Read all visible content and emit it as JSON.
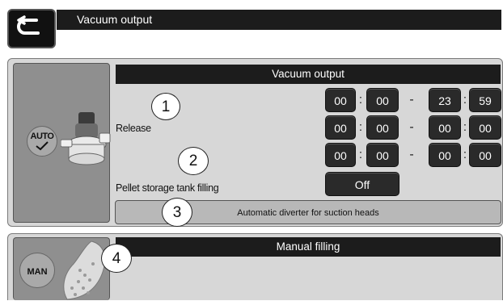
{
  "header": {
    "title": "Vacuum output"
  },
  "auto_section": {
    "mode_label": "AUTO",
    "title": "Vacuum output",
    "release_label": "Release",
    "pellet_label": "Pellet storage tank filling",
    "time_windows": [
      {
        "start_h": "00",
        "start_m": "00",
        "end_h": "23",
        "end_m": "59"
      },
      {
        "start_h": "00",
        "start_m": "00",
        "end_h": "00",
        "end_m": "00"
      },
      {
        "start_h": "00",
        "start_m": "00",
        "end_h": "00",
        "end_m": "00"
      }
    ],
    "separator": ":",
    "dash": "-",
    "pellet_value": "Off",
    "diverter_label": "Automatic diverter for suction heads"
  },
  "manual_section": {
    "mode_label": "MAN",
    "title": "Manual filling"
  },
  "callouts": [
    "1",
    "2",
    "3",
    "4"
  ],
  "icons": {
    "back": "back-arrow-icon",
    "auto_check": "checkmark-icon",
    "vacuum": "vacuum-turbine-icon",
    "pellets": "pellet-pile-icon"
  }
}
